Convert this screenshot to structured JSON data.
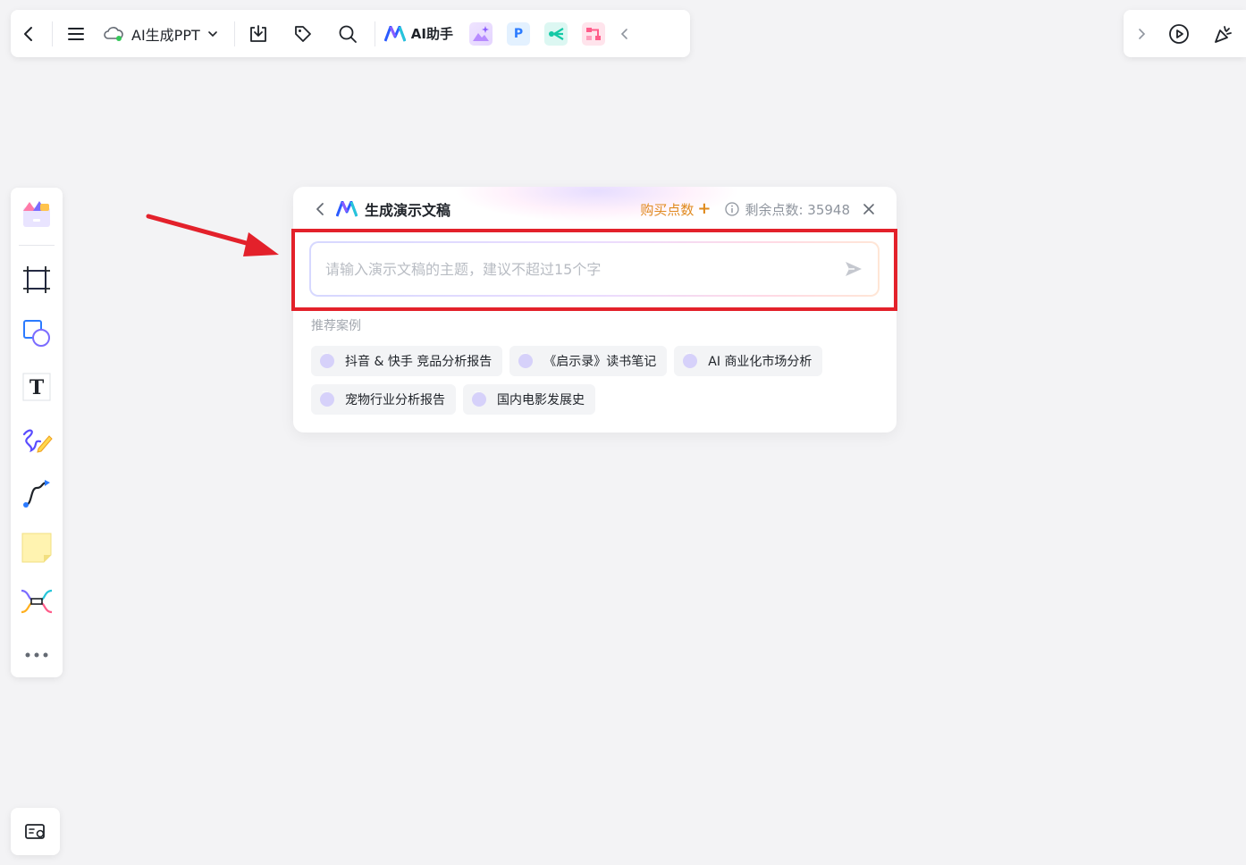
{
  "toolbar": {
    "doc_title": "AI生成PPT",
    "ai_assistant_label": "AI助手",
    "plugin_p_label": "P",
    "colors": {
      "brand_blue": "#2b5bff",
      "cloud_green": "#34c759"
    },
    "icons": [
      "back-icon",
      "menu-icon",
      "cloud-sync-icon",
      "chevron-down-icon",
      "download-icon",
      "tag-icon",
      "search-icon",
      "ai-logo-icon",
      "image-gen-plugin-icon",
      "ppt-plugin-icon",
      "mindmap-plugin-icon",
      "flowchart-plugin-icon",
      "collapse-left-icon"
    ]
  },
  "toolbar_right": {
    "icons": [
      "expand-right-icon",
      "play-icon",
      "celebrate-icon"
    ]
  },
  "sidebar": {
    "items": [
      "template-icon",
      "frame-icon",
      "shape-icon",
      "text-icon",
      "pen-icon",
      "connector-icon",
      "sticky-note-icon",
      "mindmap-icon",
      "more-icon"
    ],
    "text_tool_glyph": "T"
  },
  "panel": {
    "title": "生成演示文稿",
    "buy_points": "购买点数",
    "buy_plus": "+",
    "remaining_label": "剩余点数: 35948",
    "input_placeholder": "请输入演示文稿的主题，建议不超过15个字",
    "input_value": "",
    "recommend_label": "推荐案例",
    "examples": [
      "抖音 & 快手 竞品分析报告",
      "《启示录》读书笔记",
      "AI 商业化市场分析",
      "宠物行业分析报告",
      "国内电影发展史"
    ],
    "accent_orange": "#e08a1e"
  },
  "annotation": {
    "highlight_color": "#e3212b"
  }
}
